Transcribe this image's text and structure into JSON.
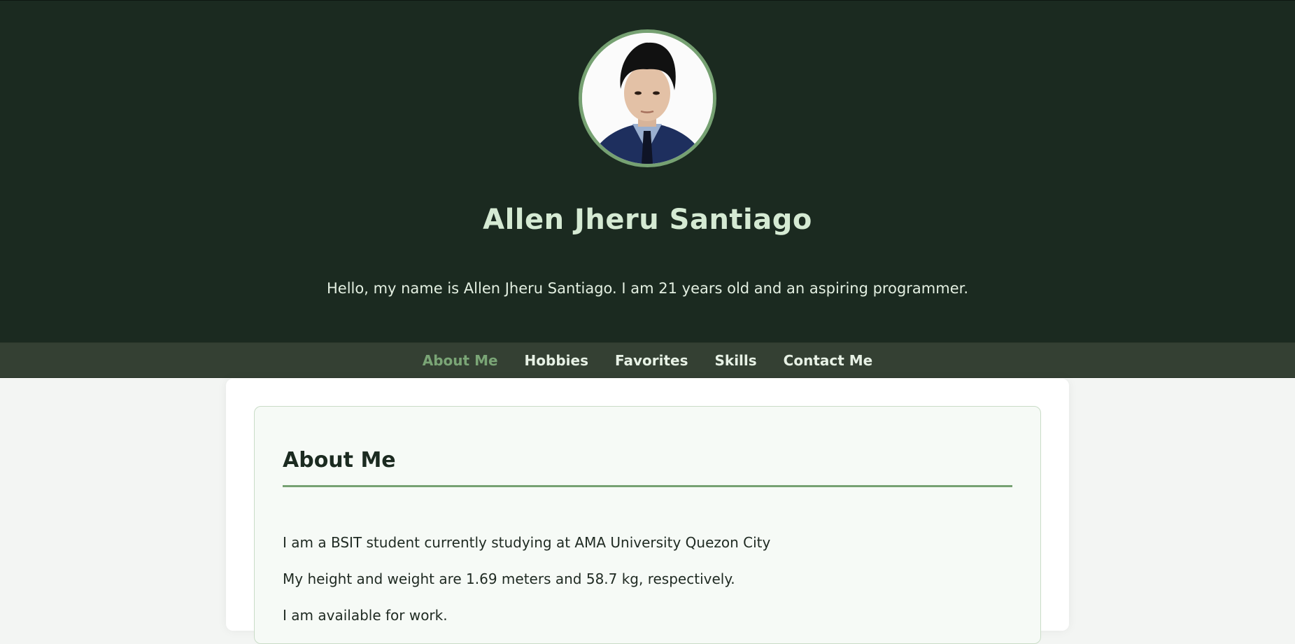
{
  "header": {
    "name": "Allen Jheru Santiago",
    "intro": "Hello, my name is Allen Jheru Santiago. I am 21 years old and an aspiring programmer."
  },
  "nav": {
    "items": [
      {
        "label": "About Me",
        "active": true
      },
      {
        "label": "Hobbies",
        "active": false
      },
      {
        "label": "Favorites",
        "active": false
      },
      {
        "label": "Skills",
        "active": false
      },
      {
        "label": "Contact Me",
        "active": false
      }
    ]
  },
  "about": {
    "title": "About Me",
    "paragraphs": [
      "I am a BSIT student currently studying at AMA University Quezon City",
      "My height and weight are 1.69 meters and 58.7 kg, respectively.",
      "I am available for work."
    ]
  },
  "colors": {
    "header_bg": "#1b2a20",
    "nav_bg": "#344033",
    "accent": "#76a172",
    "name_text": "#d5ead3"
  }
}
